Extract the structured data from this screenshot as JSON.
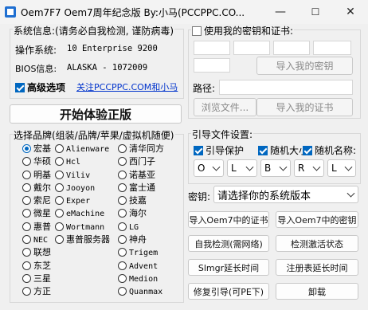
{
  "window": {
    "title": "Oem7F7 Oem7周年纪念版   By:小马(PCCPPC.CO...",
    "minimize": "—",
    "maximize": "☐",
    "close": "✕"
  },
  "info": {
    "header": "系统信息:(请务必自我检测, 谨防病毒)",
    "os_label": "操作系统:",
    "os_value": "10 Enterprise 9200",
    "bios_label": "BIOS信息:",
    "bios_value": "ALASKA - 1072009",
    "advanced_label": "高级选项",
    "link_text": "关注PCCPPC.COM和小马"
  },
  "start_button": "开始体验正版",
  "brand_header": "选择品牌(组装/品牌/苹果/虚拟机随便)",
  "brands": {
    "col1": [
      "宏基",
      "华硕",
      "明基",
      "戴尔",
      "索尼",
      "微星",
      "惠普",
      "NEC",
      "联想",
      "东芝",
      "三星",
      "方正"
    ],
    "col2": [
      "Alienware",
      "Hcl",
      "Viliv",
      "Jooyon",
      "Exper",
      "eMachine",
      "Wortmann",
      "惠普服务器"
    ],
    "col3": [
      "清华同方",
      "西门子",
      "诺基亚",
      "富士通",
      "技嘉",
      "海尔",
      "LG",
      "神舟",
      "Trigem",
      "Advent",
      "Medion",
      "Quanmax"
    ],
    "selected": "宏基"
  },
  "cert": {
    "use_own_label": "使用我的密钥和证书:",
    "import_key": "导入我的密钥",
    "path_label": "路径:",
    "browse": "浏览文件...",
    "import_cert": "导入我的证书"
  },
  "boot": {
    "header": "引导文件设置:",
    "protect": "引导保护",
    "random_size": "随机大小",
    "random_name": "随机名称:",
    "drops": [
      "O",
      "L",
      "B",
      "R",
      "L"
    ]
  },
  "key": {
    "label": "密钥:",
    "placeholder": "请选择你的系统版本"
  },
  "buttons": {
    "import_oem7_cert": "导入Oem7中的证书",
    "import_oem7_key": "导入Oem7中的密钥",
    "self_check": "自我检测(需网络)",
    "check_activation": "检测激活状态",
    "slmgr": "Slmgr延长时间",
    "registry": "注册表延长时间",
    "repair_boot": "修复引导(可PE下)",
    "uninstall": "卸载"
  }
}
